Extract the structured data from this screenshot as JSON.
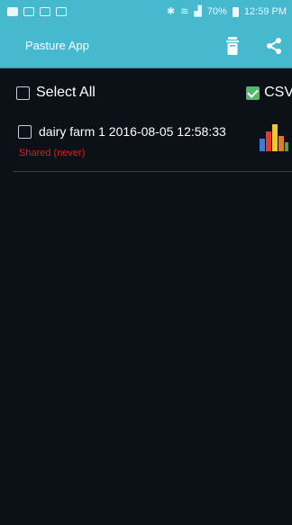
{
  "status_bar": {
    "time": "12:59 PM",
    "battery": "70%"
  },
  "app_bar": {
    "title": "Pasture App",
    "delete_icon": "trash-icon",
    "share_icon": "share-icon",
    "color": "#46b9cf"
  },
  "select_row": {
    "select_all_label": "Select All",
    "select_all_checked": false,
    "csv_label": "CSV",
    "csv_checked": true
  },
  "records": [
    {
      "title": "dairy farm 1 2016-08-05 12:58:33",
      "status": "Shared (never)",
      "checked": false,
      "icon": "bar-chart-icon"
    }
  ],
  "colors": {
    "status_text": "#d42020",
    "checked": "#52b86c"
  }
}
